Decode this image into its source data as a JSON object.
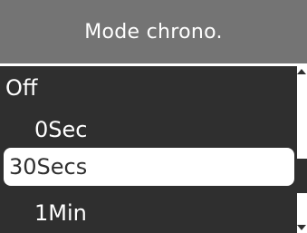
{
  "title": "Mode chrono.",
  "menu": {
    "current_value": "Off",
    "options": [
      "0Sec",
      "30Secs",
      "1Min"
    ],
    "selected_index": 1
  },
  "scroll": {
    "position": 0.74
  },
  "colors": {
    "title_background": "#747474",
    "list_background": "#2f2f2f",
    "highlight_background": "#ffffff",
    "text": "#ffffff",
    "selected_text": "#2f2f2f"
  }
}
